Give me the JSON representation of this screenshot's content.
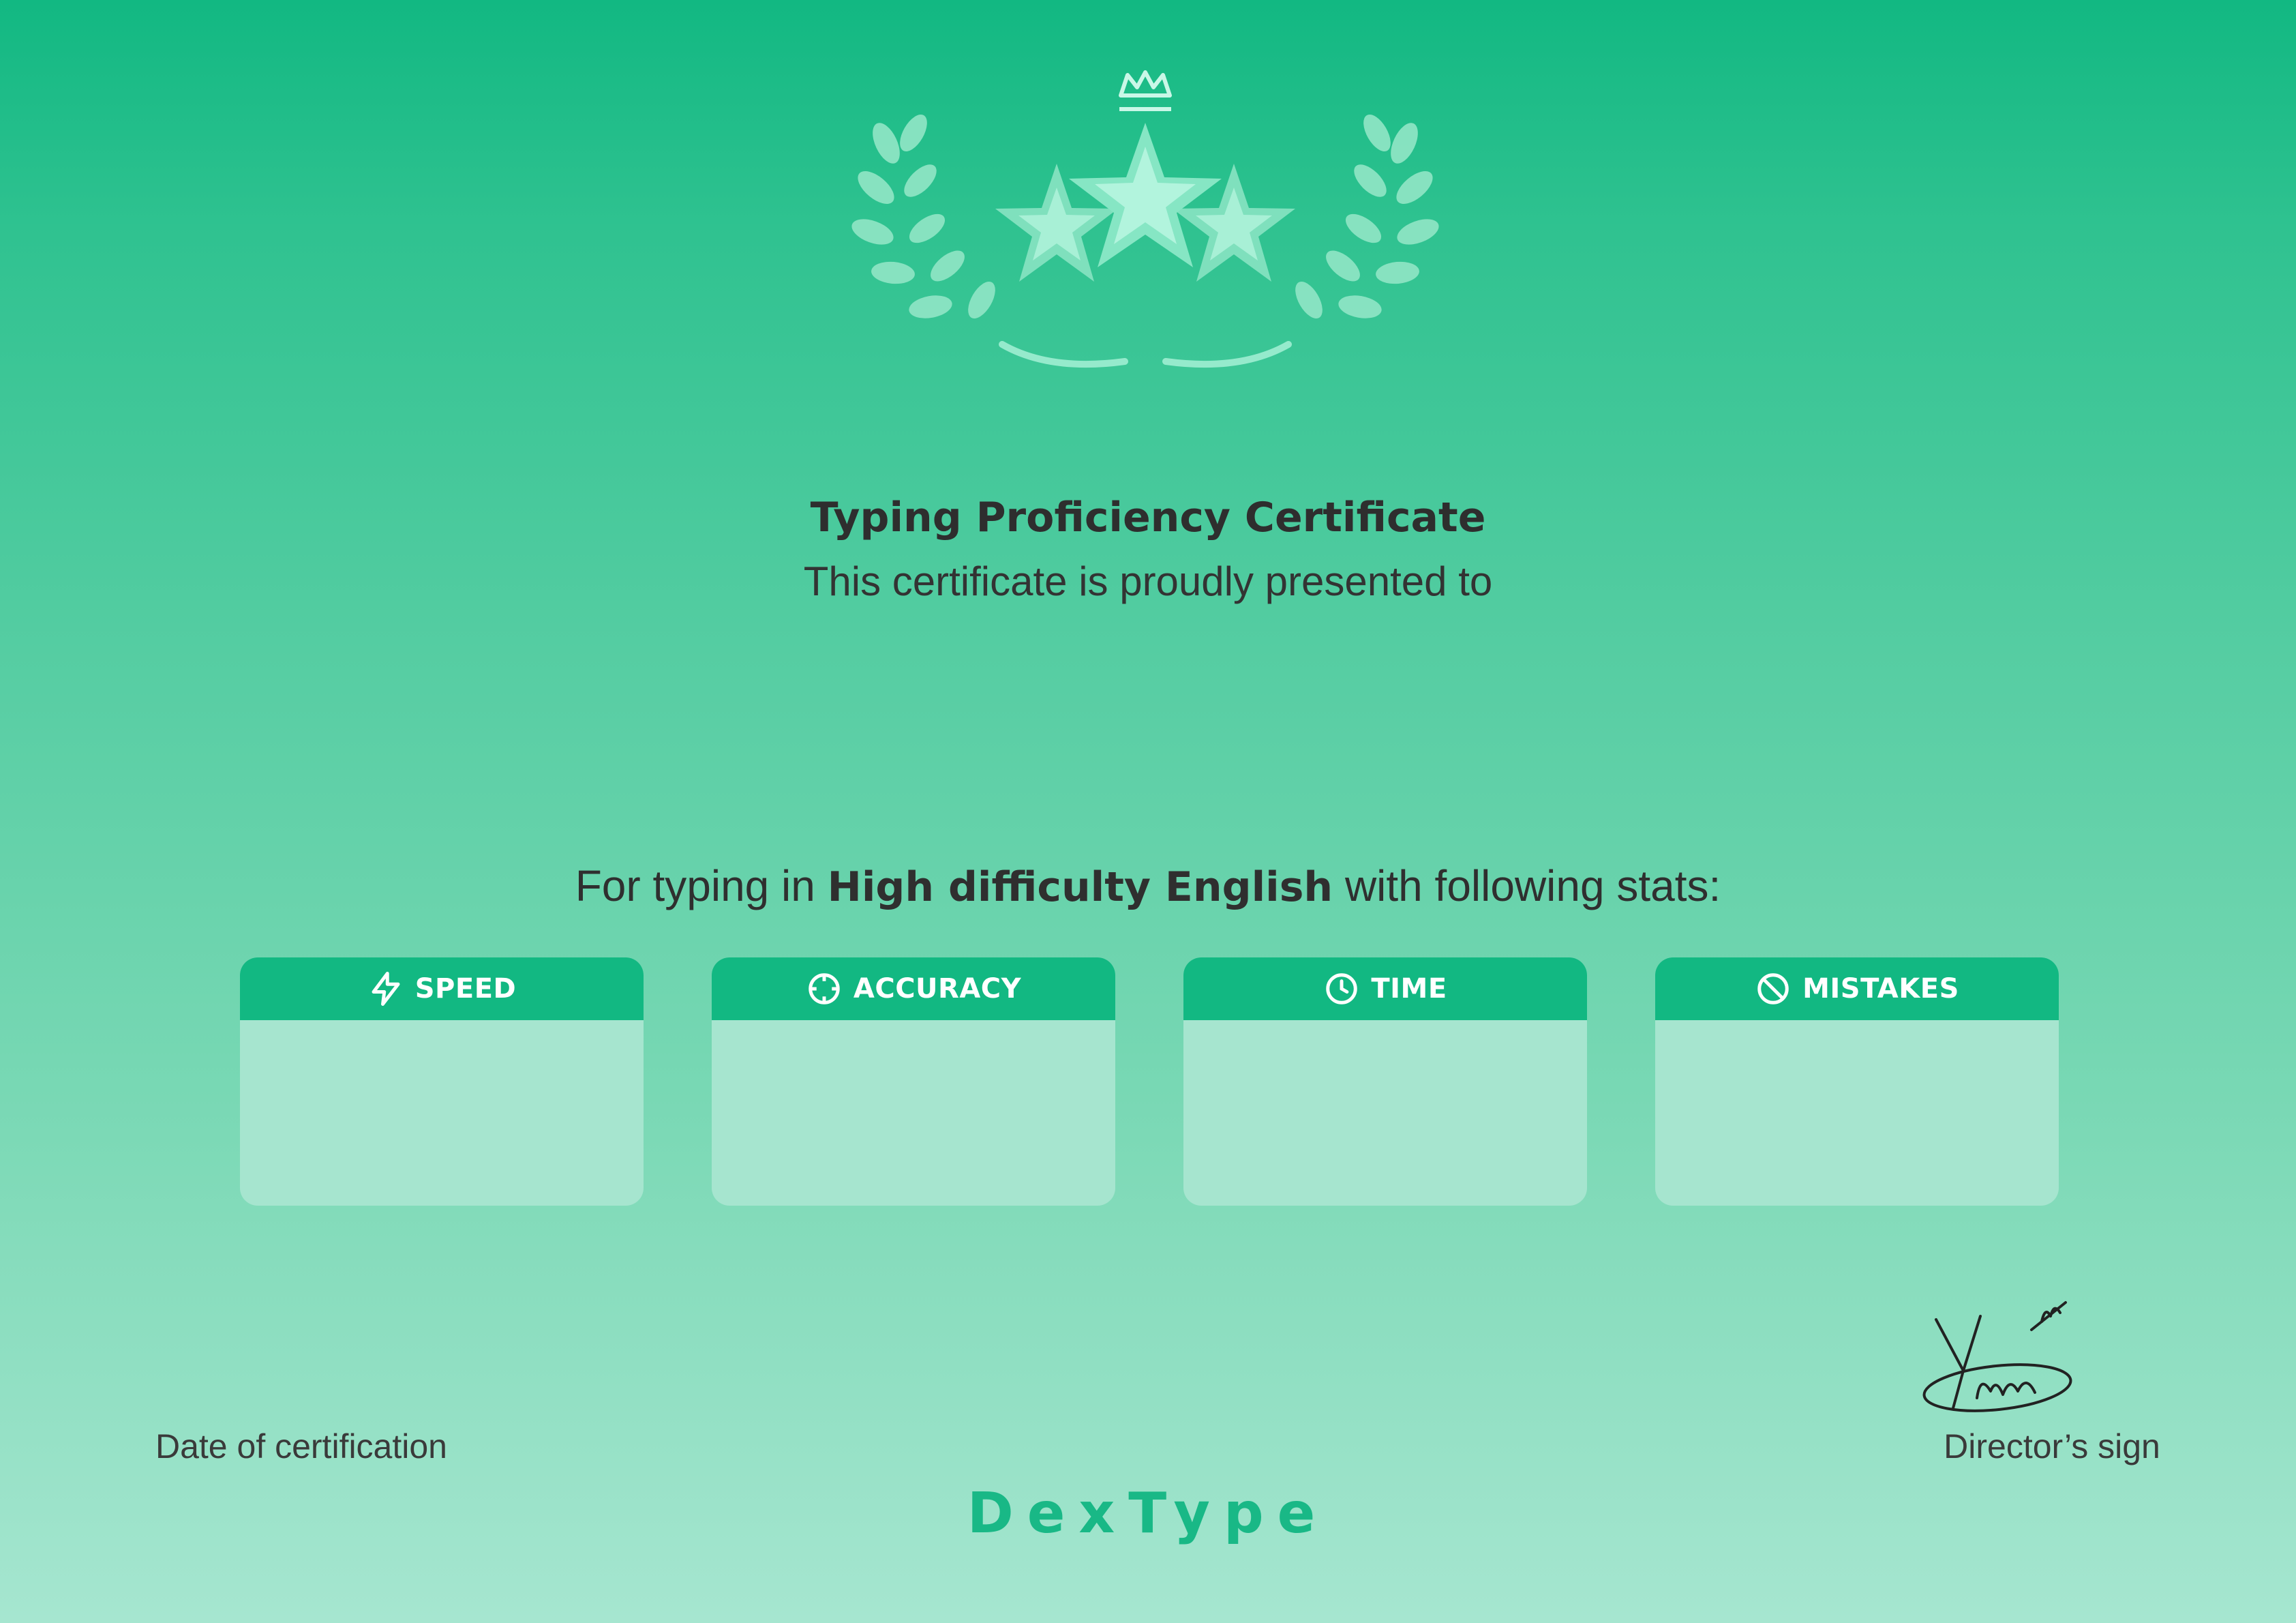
{
  "certificate": {
    "title": "Typing Proficiency Certificate",
    "subtitle": "This certificate is proudly presented to",
    "stats_intro": {
      "before": "For typing in ",
      "bold": "High difficulty English",
      "after": " with following stats:"
    }
  },
  "stats": [
    {
      "label": "SPEED",
      "icon": "lightning-icon"
    },
    {
      "label": "ACCURACY",
      "icon": "target-icon"
    },
    {
      "label": "TIME",
      "icon": "clock-icon"
    },
    {
      "label": "MISTAKES",
      "icon": "prohibited-icon"
    }
  ],
  "footer": {
    "date_label": "Date of certification",
    "director_label": "Director’s sign",
    "signature_text": "Yana",
    "brand": "DexType"
  },
  "colors": {
    "gradient_top": "#12b882",
    "gradient_bottom": "#a6e6d0",
    "card_header": "#12b882",
    "card_body": "#a6e5cf",
    "brand": "#19b886",
    "emblem": "#9aeccf"
  }
}
